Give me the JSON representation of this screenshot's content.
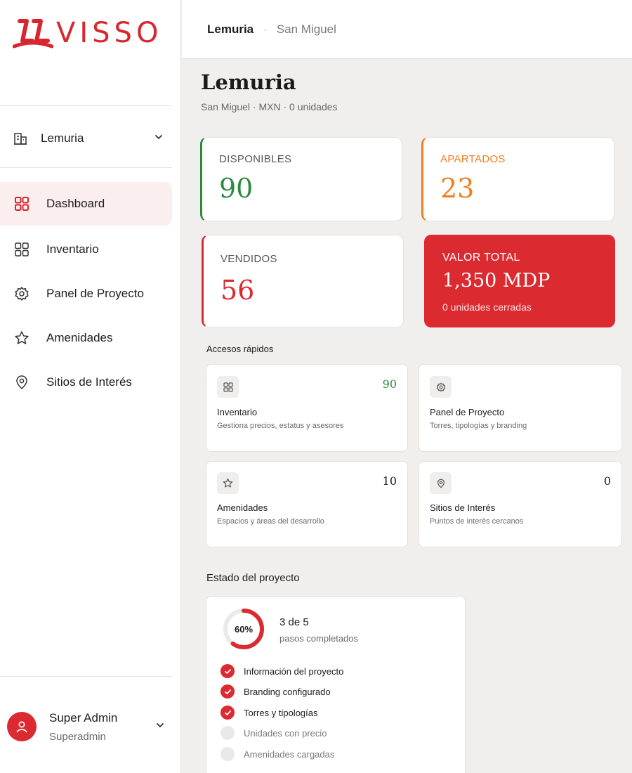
{
  "brand": {
    "logo_text": "VISSO",
    "accent": "#d8262e"
  },
  "sidebar": {
    "project_selector": {
      "name": "Lemuria",
      "icon": "building-icon"
    },
    "nav": [
      {
        "label": "Dashboard",
        "icon": "grid-icon",
        "active": true
      },
      {
        "label": "Inventario",
        "icon": "grid-icon",
        "active": false
      },
      {
        "label": "Panel de Proyecto",
        "icon": "gear-icon",
        "active": false
      },
      {
        "label": "Amenidades",
        "icon": "star-icon",
        "active": false
      },
      {
        "label": "Sitios de Interés",
        "icon": "map-pin-icon",
        "active": false
      }
    ],
    "user": {
      "name": "Super Admin",
      "role": "Superadmin",
      "icon": "user-icon"
    }
  },
  "topbar": {
    "breadcrumb": [
      "Lemuria",
      "San Miguel"
    ],
    "separator": "·"
  },
  "header": {
    "title": "Lemuria",
    "subtitle": "San Miguel · MXN · 0 unidades"
  },
  "stats": {
    "disponibles": {
      "label": "DISPONIBLES",
      "value": "90",
      "color": "#2c8a3e"
    },
    "apartados": {
      "label": "APARTADOS",
      "value": "23",
      "color": "#ef7d22"
    },
    "vendidos": {
      "label": "VENDIDOS",
      "value": "56",
      "color": "#dc2a31"
    },
    "valor_total": {
      "label": "VALOR TOTAL",
      "value": "1,350 MDP",
      "note": "0 unidades cerradas",
      "color": "#db2a30"
    }
  },
  "quick_access": {
    "heading": "Accesos rápidos",
    "items": [
      {
        "title": "Inventario",
        "desc": "Gestiona precios, estatus y asesores",
        "count": "90",
        "count_color": "#2c8a3e",
        "icon": "grid-icon"
      },
      {
        "title": "Panel de Proyecto",
        "desc": "Torres, tipologías y branding",
        "count": "",
        "icon": "gear-icon"
      },
      {
        "title": "Amenidades",
        "desc": "Espacios y áreas del desarrollo",
        "count": "10",
        "count_color": "#1d1d1d",
        "icon": "star-icon"
      },
      {
        "title": "Sitios de Interés",
        "desc": "Puntos de interés cercanos",
        "count": "0",
        "count_color": "#1d1d1d",
        "icon": "map-pin-icon"
      }
    ]
  },
  "project_status": {
    "heading": "Estado del proyecto",
    "percent_label": "60%",
    "progress": 0.6,
    "summary": "3 de 5",
    "summary_sub": "pasos completados",
    "steps": [
      {
        "label": "Información del proyecto",
        "done": true
      },
      {
        "label": "Branding configurado",
        "done": true
      },
      {
        "label": "Torres y tipologías",
        "done": true
      },
      {
        "label": "Unidades con precio",
        "done": false
      },
      {
        "label": "Amenidades cargadas",
        "done": false
      }
    ]
  }
}
